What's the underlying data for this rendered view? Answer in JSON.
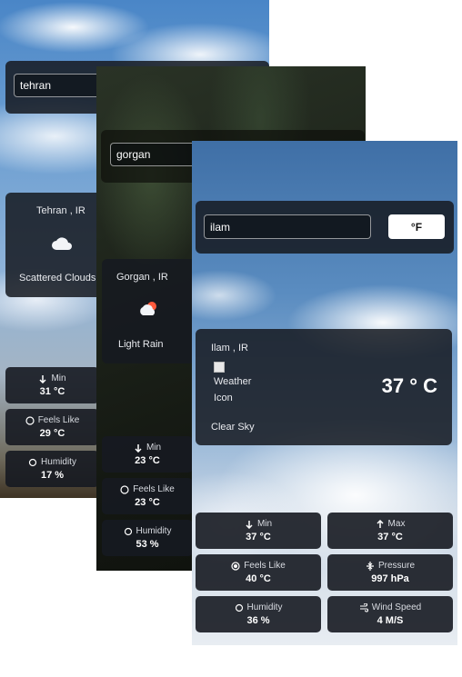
{
  "cards": {
    "tehran": {
      "search_value": "tehran",
      "location": "Tehran , IR",
      "condition": "Scattered Clouds",
      "icon": "cloud-icon",
      "stats": {
        "min_label": "Min",
        "min_value": "31 °C",
        "feels_label": "Feels Like",
        "feels_value": "29 °C",
        "humidity_label": "Humidity",
        "humidity_value": "17 %"
      }
    },
    "gorgan": {
      "search_value": "gorgan",
      "location": "Gorgan , IR",
      "condition": "Light Rain",
      "icon": "rain-cloud-icon",
      "stats": {
        "min_label": "Min",
        "min_value": "23 °C",
        "feels_label": "Feels Like",
        "feels_value": "23 °C",
        "humidity_label": "Humidity",
        "humidity_value": "53 %"
      }
    },
    "ilam": {
      "search_value": "ilam",
      "unit_button": "°F",
      "location": "Ilam , IR",
      "icon_alt": "Weather Icon",
      "temperature": "37 ° C",
      "condition": "Clear Sky",
      "stats": {
        "min_label": "Min",
        "min_value": "37 °C",
        "max_label": "Max",
        "max_value": "37 °C",
        "feels_label": "Feels Like",
        "feels_value": "40 °C",
        "pressure_label": "Pressure",
        "pressure_value": "997 hPa",
        "humidity_label": "Humidity",
        "humidity_value": "36 %",
        "wind_label": "Wind Speed",
        "wind_value": "4 M/S"
      }
    }
  },
  "colors": {
    "panel": "#161a21",
    "accent": "#ffffff"
  }
}
